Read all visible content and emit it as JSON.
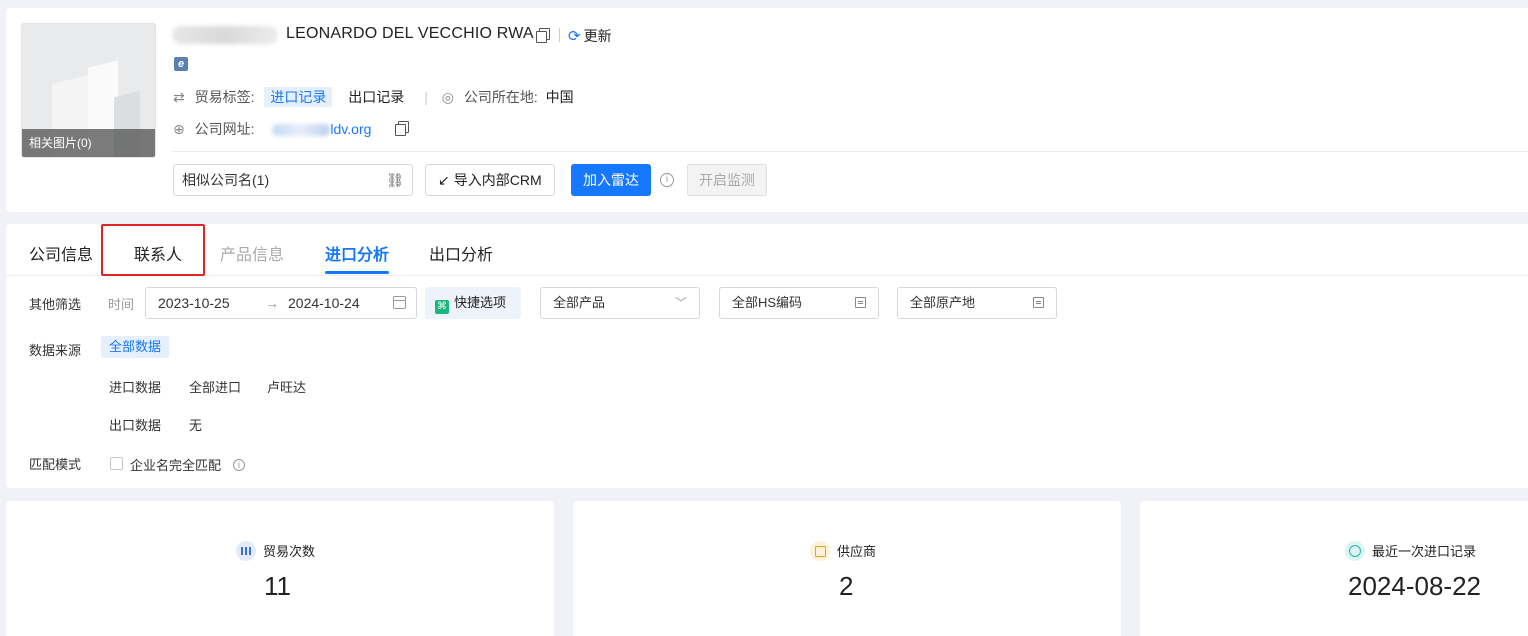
{
  "company": {
    "logo_caption": "相关图片(0)",
    "name": "LEONARDO DEL VECCHIO RWA",
    "refresh_label": "更新",
    "trade_tag_label": "贸易标签:",
    "trade_tags": [
      "进口记录",
      "出口记录"
    ],
    "location_label": "公司所在地:",
    "location_value": "中国",
    "website_label": "公司网址:",
    "website_value": "ldv.org"
  },
  "actions": {
    "similar_name": "相似公司名(1)",
    "import_crm": "导入内部CRM",
    "add_radar": "加入雷达",
    "monitor": "开启监测"
  },
  "tabs": [
    {
      "label": "公司信息"
    },
    {
      "label": "联系人"
    },
    {
      "label": "产品信息"
    },
    {
      "label": "进口分析"
    },
    {
      "label": "出口分析"
    }
  ],
  "filters": {
    "other_label": "其他筛选",
    "time_label": "时间",
    "date_start": "2023-10-25",
    "date_arrow": "→",
    "date_end": "2024-10-24",
    "quick_label": "快捷选项",
    "product_select": "全部产品",
    "hs_select": "全部HS编码",
    "origin_select": "全部原产地",
    "source_label": "数据来源",
    "source_all": "全部数据",
    "import_data_label": "进口数据",
    "import_scope": "全部进口",
    "import_country": "卢旺达",
    "export_data_label": "出口数据",
    "export_value": "无",
    "match_label": "匹配模式",
    "exact_match": "企业名完全匹配"
  },
  "stats": [
    {
      "title": "贸易次数",
      "value": "11",
      "icon": "bar-chart-icon"
    },
    {
      "title": "供应商",
      "value": "2",
      "icon": "supplier-icon"
    },
    {
      "title": "最近一次进口记录",
      "value": "2024-08-22",
      "icon": "clock-icon"
    }
  ],
  "colors": {
    "accent": "#1677ff",
    "highlight_border": "#e02424"
  }
}
